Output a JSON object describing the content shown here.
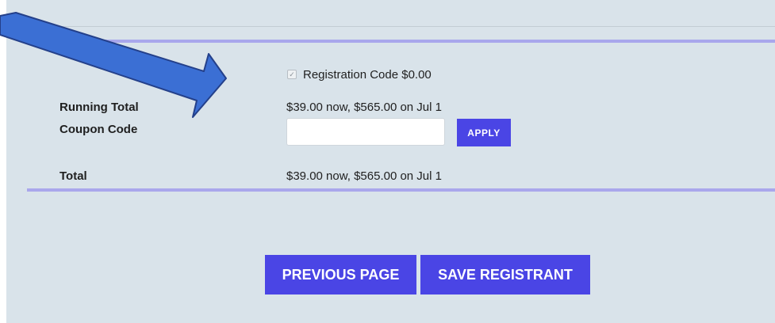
{
  "registration": {
    "checkbox_checked": true,
    "code_label": "Registration Code $0.00"
  },
  "running_total": {
    "label": "Running Total",
    "value": "$39.00 now, $565.00 on Jul 1"
  },
  "coupon": {
    "label": "Coupon Code",
    "value": "",
    "apply_label": "APPLY"
  },
  "total": {
    "label": "Total",
    "value": "$39.00 now, $565.00 on Jul 1"
  },
  "buttons": {
    "previous_label": "PREVIOUS PAGE",
    "save_label": "SAVE REGISTRANT"
  },
  "colors": {
    "accent": "#4a45e5",
    "panel_bg": "#d9e3ea",
    "divider": "#a9a7ec",
    "annotation_arrow": "#3b6fd4"
  }
}
